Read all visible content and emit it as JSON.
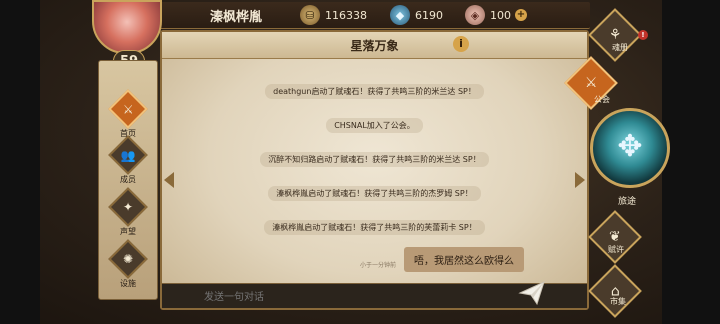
{
  "player": {
    "name": "溱枫桦胤",
    "level": "59"
  },
  "resources": [
    {
      "icon": "gold-coin-icon",
      "value": "116338"
    },
    {
      "icon": "blue-crystal-icon",
      "value": "6190"
    },
    {
      "icon": "pink-gem-icon",
      "value": "100"
    }
  ],
  "left_nav": [
    {
      "label": "首页",
      "icon": "home-icon"
    },
    {
      "label": "成员",
      "icon": "members-icon"
    },
    {
      "label": "声望",
      "icon": "reputation-icon"
    },
    {
      "label": "设施",
      "icon": "facility-icon"
    }
  ],
  "panel": {
    "title": "星落万象",
    "messages": [
      "deathgun启动了赋魂石！获得了共鸣三阶的米兰达 SP！",
      "CHSNAL加入了公会。",
      "沉醉不知归路启动了赋魂石！获得了共鸣三阶的米兰达 SP！",
      "溱枫桦胤启动了赋魂石！获得了共鸣三阶的杰罗姆 SP！",
      "溱枫桦胤启动了赋魂石！获得了共鸣三阶的芙蕾莉卡 SP！"
    ],
    "chat": {
      "time": "小于一分钟前",
      "text": "唔，我居然这么欧得么"
    },
    "input_placeholder": "发送一句对话"
  },
  "right_nav": [
    {
      "label": "魂册",
      "icon": "soulbook-icon"
    },
    {
      "label": "公会",
      "icon": "guild-icon"
    },
    {
      "label": "旅途",
      "icon": "journey-icon"
    },
    {
      "label": "赋许",
      "icon": "endow-icon"
    },
    {
      "label": "市集",
      "icon": "market-icon"
    }
  ]
}
